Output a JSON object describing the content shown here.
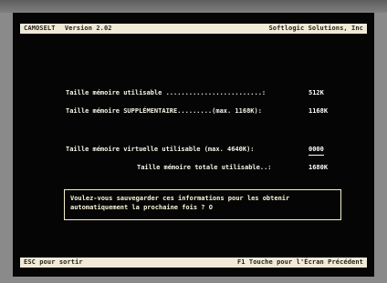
{
  "header": {
    "app": "CAMOSELT",
    "version": "Version 2.02",
    "publisher": "Softlogic Solutions, Inc"
  },
  "memory": {
    "usable_label": "Taille mémoire utilisable .........................:",
    "usable_value": "512K",
    "extra_label": "Taille mémoire SUPPLÉMENTAIRE.........(max. 1168K):",
    "extra_value": "1168K",
    "virtual_label": "Taille mémoire virtuelle utilisable (max. 4640K):",
    "virtual_value": "0000",
    "total_label": "Taille mémoire totale utilisable..:",
    "total_value": "1680K"
  },
  "prompt": {
    "line1": "Voulez-vous sauvegarder ces informations pour les obtenir",
    "line2": "automatiquement la prochaine fois ? O"
  },
  "footer": {
    "left": "ESC pour sortir",
    "right": "F1 Touche pour l'Écran Précédent"
  }
}
